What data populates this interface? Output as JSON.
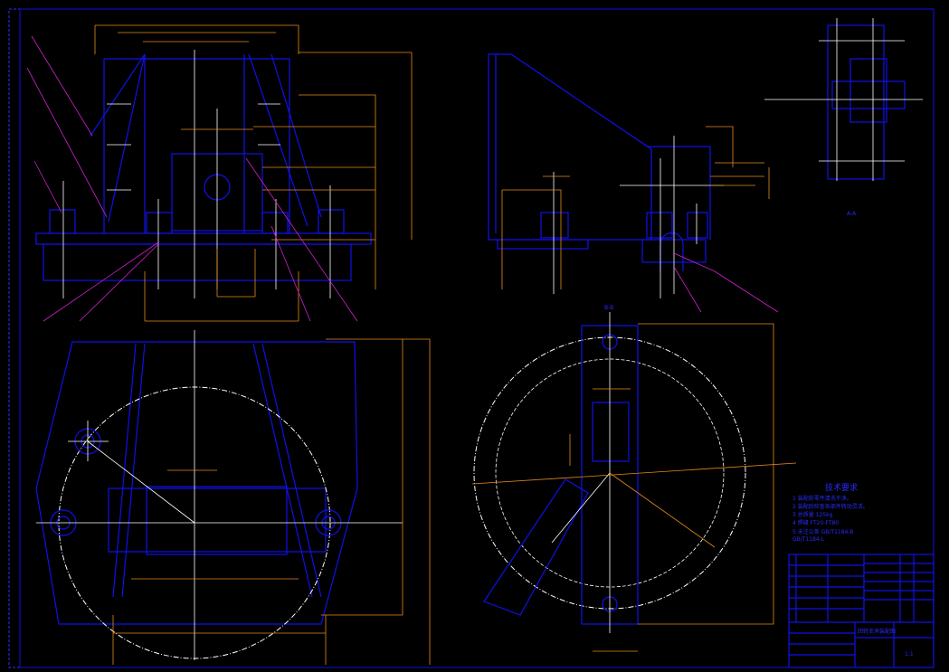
{
  "drawing": {
    "tech_req_title": "技术要求",
    "tech_req": [
      "1 装配前零件清洗干净。",
      "2 装配后检查各部件转动灵活。",
      "3 总质量 125kg",
      "4 焊缝 FT20-FT80",
      "5 未注公差 GB/T1184-B",
      "GB/T1184-L"
    ],
    "section_label_a": "A-A",
    "section_label_b": "B-B",
    "title_block": {
      "drawing_name": "回转支承装配图",
      "scale": "1:1"
    },
    "colors": {
      "outline": "#1010e8",
      "dimension": "#e88a1a",
      "centerline": "#ffffff",
      "leader": "#d020d0"
    }
  }
}
